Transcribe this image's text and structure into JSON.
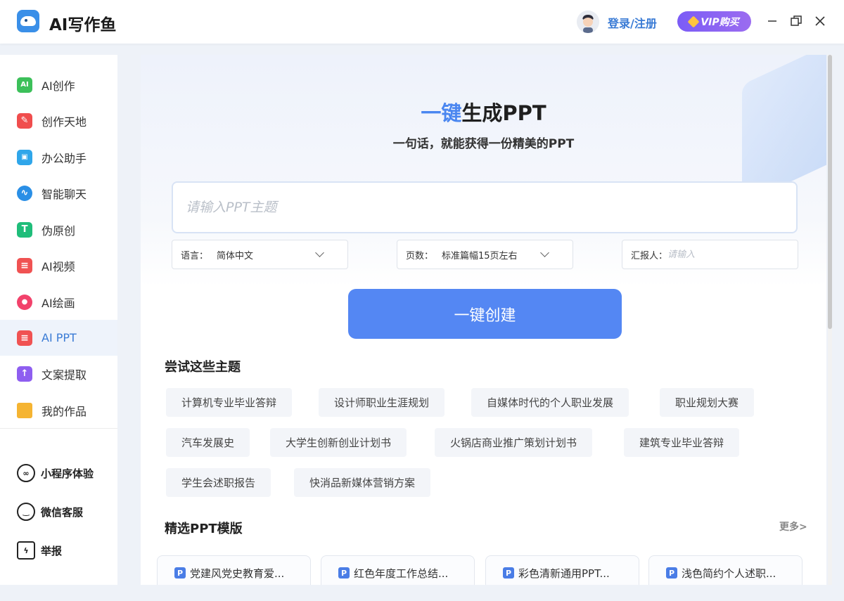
{
  "app": {
    "title": "AI写作鱼",
    "login": "登录/注册",
    "vip": "VIP购买"
  },
  "sidebar": {
    "items": [
      {
        "label": "AI创作",
        "icon": "ai-create-icon",
        "color": "#3cc05a",
        "glyph": "AI"
      },
      {
        "label": "创作天地",
        "icon": "pencil-icon",
        "color": "#f04d4d",
        "glyph": "✎"
      },
      {
        "label": "办公助手",
        "icon": "briefcase-icon",
        "color": "#2fa6ea",
        "glyph": "▣"
      },
      {
        "label": "智能聊天",
        "icon": "chat-icon",
        "color": "#2a8fe6",
        "glyph": "∿"
      },
      {
        "label": "伪原创",
        "icon": "rewrite-icon",
        "color": "#1fbd7a",
        "glyph": "T"
      },
      {
        "label": "AI视频",
        "icon": "video-icon",
        "color": "#f05252",
        "glyph": "≡"
      },
      {
        "label": "AI绘画",
        "icon": "palette-icon",
        "color": "#f2426b",
        "glyph": "●"
      },
      {
        "label": "AI PPT",
        "icon": "ppt-icon",
        "color": "#f05252",
        "glyph": "≡"
      },
      {
        "label": "文案提取",
        "icon": "extract-icon",
        "color": "#8e5ef0",
        "glyph": "↑"
      },
      {
        "label": "我的作品",
        "icon": "folder-icon",
        "color": "#f5b432",
        "glyph": ""
      }
    ],
    "bottom": [
      {
        "label": "小程序体验",
        "icon": "mini-program-icon"
      },
      {
        "label": "微信客服",
        "icon": "wechat-service-icon"
      },
      {
        "label": "举报",
        "icon": "report-icon"
      }
    ]
  },
  "main": {
    "title_accent": "一键",
    "title_rest": "生成PPT",
    "subtitle": "一句话，就能获得一份精美的PPT",
    "input_placeholder": "请输入PPT主题",
    "language_label": "语言：",
    "language_value": "简体中文",
    "pages_label": "页数：",
    "pages_value": "标准篇幅15页左右",
    "reporter_label": "汇报人：",
    "reporter_placeholder": "请输入",
    "create_button": "一键创建",
    "topics_title": "尝试这些主题",
    "topics": [
      "计算机专业毕业答辩",
      "设计师职业生涯规划",
      "自媒体时代的个人职业发展",
      "职业规划大赛",
      "汽车发展史",
      "大学生创新创业计划书",
      "火锅店商业推广策划计划书",
      "建筑专业毕业答辩",
      "学生会述职报告",
      "快消品新媒体营销方案"
    ],
    "templates_title": "精选PPT模版",
    "more": "更多>",
    "templates": [
      "党建风党史教育爱...",
      "红色年度工作总结...",
      "彩色清新通用PPT...",
      "浅色简约个人述职..."
    ]
  }
}
